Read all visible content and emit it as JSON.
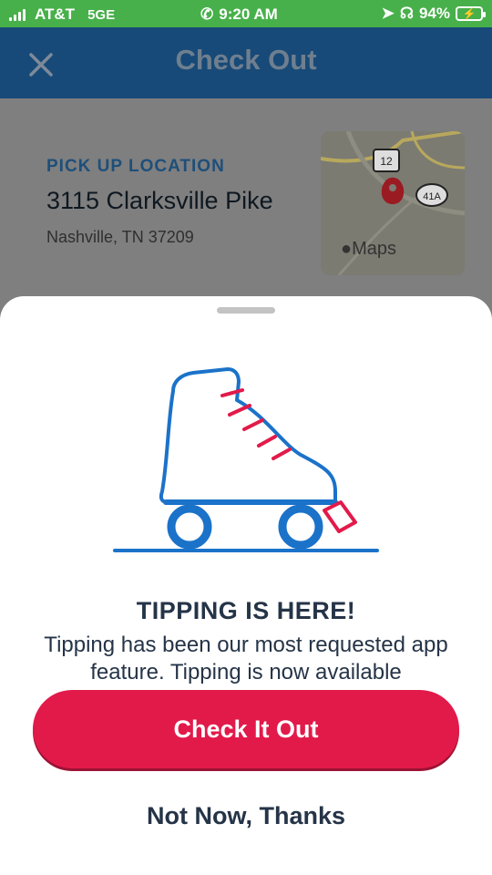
{
  "status_bar": {
    "carrier": "AT&T",
    "network": "5GE",
    "time": "9:20 AM",
    "battery": "94%"
  },
  "header": {
    "title": "Check Out"
  },
  "pickup": {
    "label": "PICK UP LOCATION",
    "street": "3115 Clarksville Pike",
    "city": "Nashville, TN 37209",
    "map_label": "Maps",
    "map_markers": [
      "12",
      "41A"
    ]
  },
  "sheet": {
    "title": "TIPPING IS HERE!",
    "body": "Tipping has been our most requested app feature. Tipping is now available",
    "primary_button": "Check It Out",
    "secondary_button": "Not Now, Thanks"
  },
  "colors": {
    "status_green": "#47b04a",
    "header_blue": "#174a78",
    "accent_red": "#e21a4a",
    "skate_blue": "#1b72c9",
    "text_dark": "#253447"
  }
}
